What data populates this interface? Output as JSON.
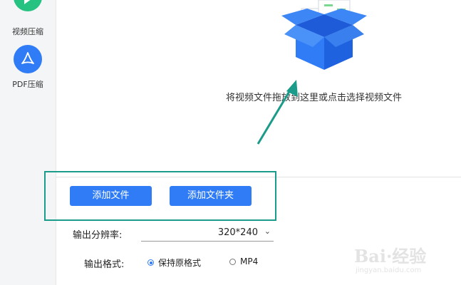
{
  "sidebar": {
    "items": [
      {
        "label": "视频压缩",
        "icon": "video-play-icon"
      },
      {
        "label": "PDF压缩",
        "icon": "pdf-icon"
      }
    ]
  },
  "dropzone": {
    "icon": "open-box-icon",
    "text": "将视频文件拖放到这里或点击选择视频文件"
  },
  "buttons": {
    "add_file": "添加文件",
    "add_folder": "添加文件夹"
  },
  "settings": {
    "resolution_label": "输出分辨率:",
    "resolution_value": "320*240",
    "format_label": "输出格式:",
    "format_options": [
      {
        "label": "保持原格式",
        "selected": true
      },
      {
        "label": "MP4",
        "selected": false
      }
    ]
  },
  "watermark": {
    "main": "Bai·经验",
    "sub": "jingyan.baidu.com"
  },
  "colors": {
    "accent": "#2f7cf6",
    "highlight_box": "#1b9b8a",
    "video_icon": "#26c281"
  }
}
